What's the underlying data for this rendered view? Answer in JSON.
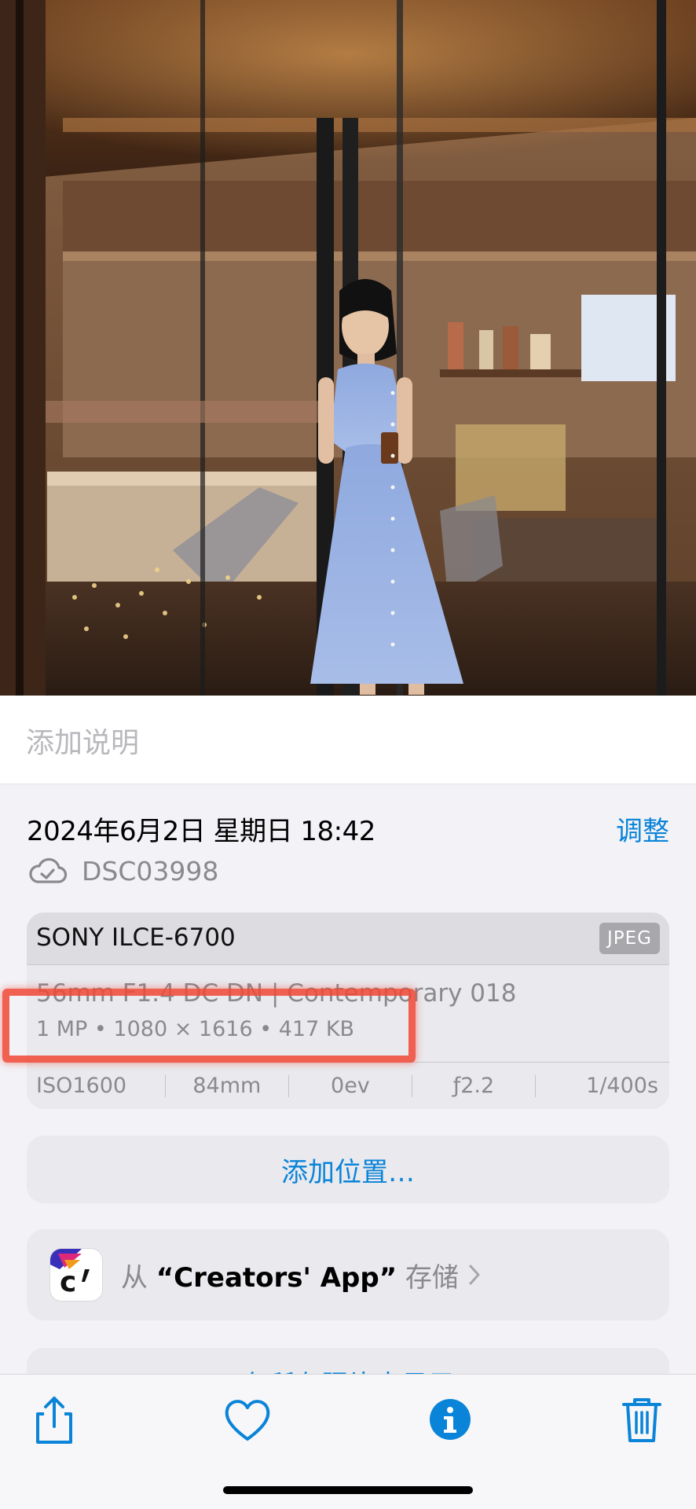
{
  "caption": {
    "placeholder": "添加说明"
  },
  "info": {
    "datetime": "2024年6月2日 星期日 18:42",
    "adjust_label": "调整",
    "filename": "DSC03998"
  },
  "exif": {
    "camera": "SONY ILCE-6700",
    "format_badge": "JPEG",
    "lens": "56mm F1.4 DC DN | Contemporary 018",
    "specs": "1 MP • 1080 × 1616 • 417 KB",
    "iso": "ISO1600",
    "focal": "84mm",
    "ev": "0ev",
    "aperture": "ƒ2.2",
    "shutter": "1/400s"
  },
  "actions": {
    "add_location": "添加位置…",
    "saved_prefix": "从",
    "saved_app": "“Creators' App”",
    "saved_suffix": "存储",
    "peek_text": "在所有照片中显示"
  },
  "toolbar": {
    "icons": [
      "share-icon",
      "heart-icon",
      "info-icon",
      "trash-icon"
    ],
    "accent": "#0a84d8"
  },
  "colors": {
    "accent": "#0a84d8",
    "highlight": "#f04834",
    "secondary_text": "#8a8a8e"
  }
}
